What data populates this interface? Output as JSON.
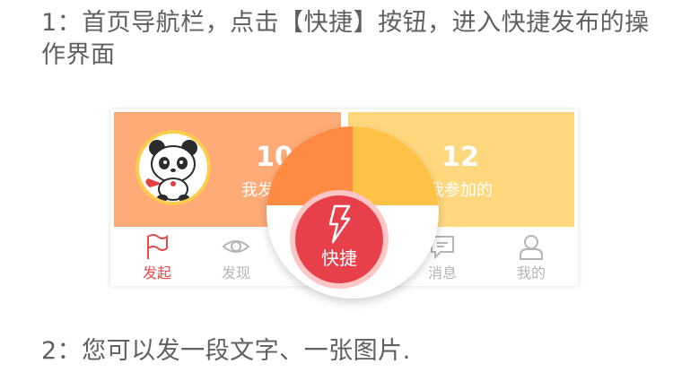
{
  "steps": {
    "step1": "1：首页导航栏，点击【快捷】按钮，进入快捷发布的操作界面",
    "step2": "2：您可以发一段文字、一张图片."
  },
  "cards": {
    "left": {
      "count": "10",
      "label": "我发起的"
    },
    "right": {
      "count": "12",
      "label": "我参加的"
    }
  },
  "tabs": {
    "publish": "发起",
    "discover": "发现",
    "quick": "快捷",
    "messages": "消息",
    "mine": "我的"
  },
  "colors": {
    "left_card": "#ffab78",
    "right_card": "#ffd87e",
    "accent_red": "#e8404b",
    "tab_inactive": "#b5b5b5",
    "tab_active": "#e84a4a"
  },
  "icons": {
    "publish": "flag-icon",
    "discover": "eye-icon",
    "quick": "lightning-icon",
    "messages": "chat-bubble-icon",
    "mine": "user-icon",
    "avatar": "panda-avatar"
  }
}
